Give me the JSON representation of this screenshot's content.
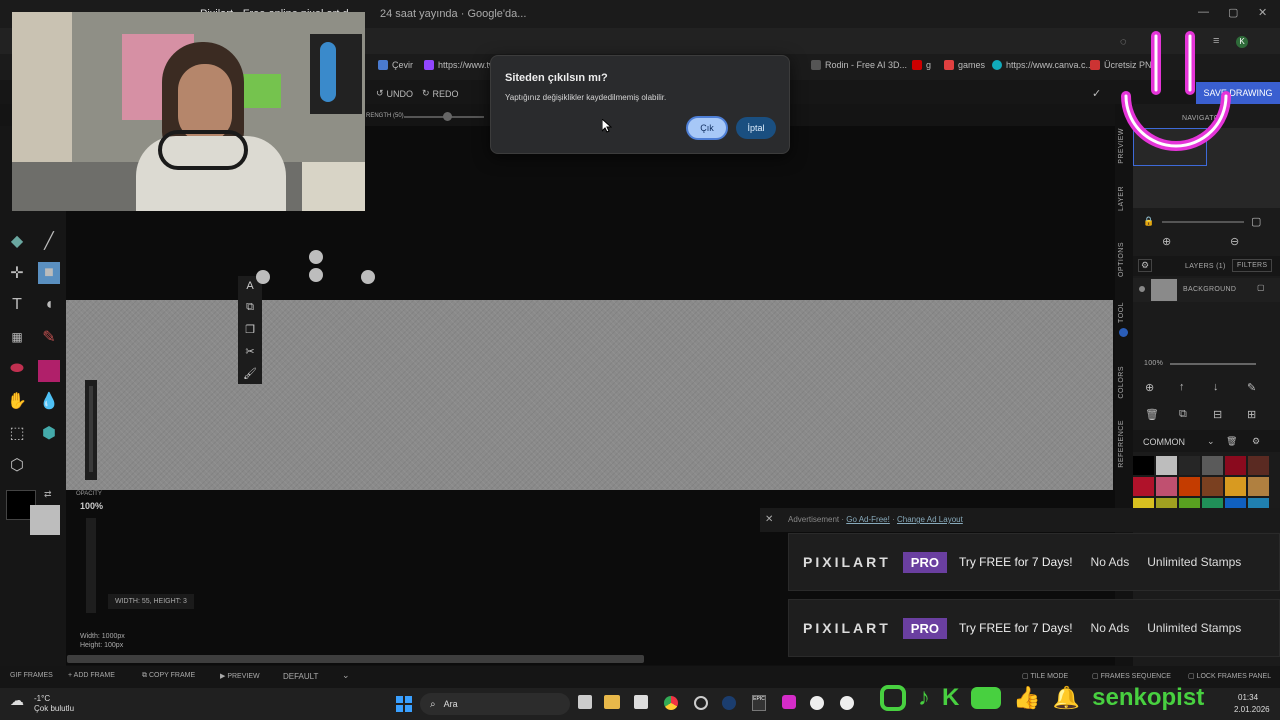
{
  "browser": {
    "tabs": [
      "24 saat yayında · Google'da...",
      "Pixilart - Free online pixel art d..."
    ],
    "bookmarks": [
      {
        "label": "Çevir",
        "color": "#4a7bd0"
      },
      {
        "label": "https://www.tw...",
        "color": "#9146ff"
      },
      {
        "label": "Rodin - Free AI 3D...",
        "color": "#333"
      },
      {
        "label": "g",
        "color": "#c00"
      },
      {
        "label": "games",
        "color": "#e04040"
      },
      {
        "label": "https://www.canva.c...",
        "color": "#1ab"
      },
      {
        "label": "Ücretsiz PN...",
        "color": "#c33"
      }
    ]
  },
  "app": {
    "undo_label": "UNDO",
    "redo_label": "REDO",
    "strength_label": "RENGTH (50)",
    "save_label": "SAVE DRAWING",
    "opacity_label": "OPACITY",
    "opacity_value": "100%",
    "brush_size": "WIDTH: 55, HEIGHT: 3",
    "canvas_width": "Width: 1000px",
    "canvas_height": "Height: 100px",
    "primary_color": "#000000",
    "secondary_color": "#bdbdbd"
  },
  "right_panel": {
    "tabs": [
      "PREVIEW",
      "LAYER",
      "OPTIONS",
      "TOOL",
      "COLORS",
      "REFERENCE"
    ],
    "navigator_label": "NAVIGATOR",
    "layers_label": "LAYERS (1)",
    "filters_label": "FILTERS",
    "layer_name": "BACKGROUND",
    "zoom_value": "100%",
    "palette_name": "COMMON",
    "palette": [
      "#000000",
      "#bdbdbd",
      "#262626",
      "#5a5a5a",
      "#8a0a1e",
      "#5a2a22",
      "#b0122a",
      "#c05070",
      "#c43c00",
      "#7a4020",
      "#d89a20",
      "#b08040",
      "#d8c020",
      "#a0a020",
      "#58a020",
      "#209058",
      "#1060c0",
      "#2080b0"
    ]
  },
  "ad": {
    "header": "Advertisement ·",
    "go_adfree": "Go Ad-Free!",
    "change_layout": "Change Ad Layout",
    "brand": "PIXILART",
    "pro": "PRO",
    "try_text": "Try FREE for 7 Days!",
    "no_ads": "No Ads",
    "stamps": "Unlimited Stamps"
  },
  "bottom": {
    "gif_frames": "GIF FRAMES",
    "add_frame": "ADD FRAME",
    "copy_frame": "COPY FRAME",
    "preview": "PREVIEW",
    "default": "DEFAULT",
    "tile_mode": "TILE MODE",
    "frames_sequence": "FRAMES SEQUENCE",
    "lock_frames": "LOCK FRAMES PANEL"
  },
  "dialog": {
    "title": "Siteden çıkılsın mı?",
    "message": "Yaptığınız değişiklikler kaydedilmemiş olabilir.",
    "ok_label": "Çık",
    "cancel_label": "İptal"
  },
  "taskbar": {
    "weather_temp": "-1°C",
    "weather_desc": "Çok bulutlu",
    "search_placeholder": "Ara",
    "time": "01:34",
    "date": "2.01.2026"
  },
  "overlay": {
    "channel_name": "senkopist"
  }
}
